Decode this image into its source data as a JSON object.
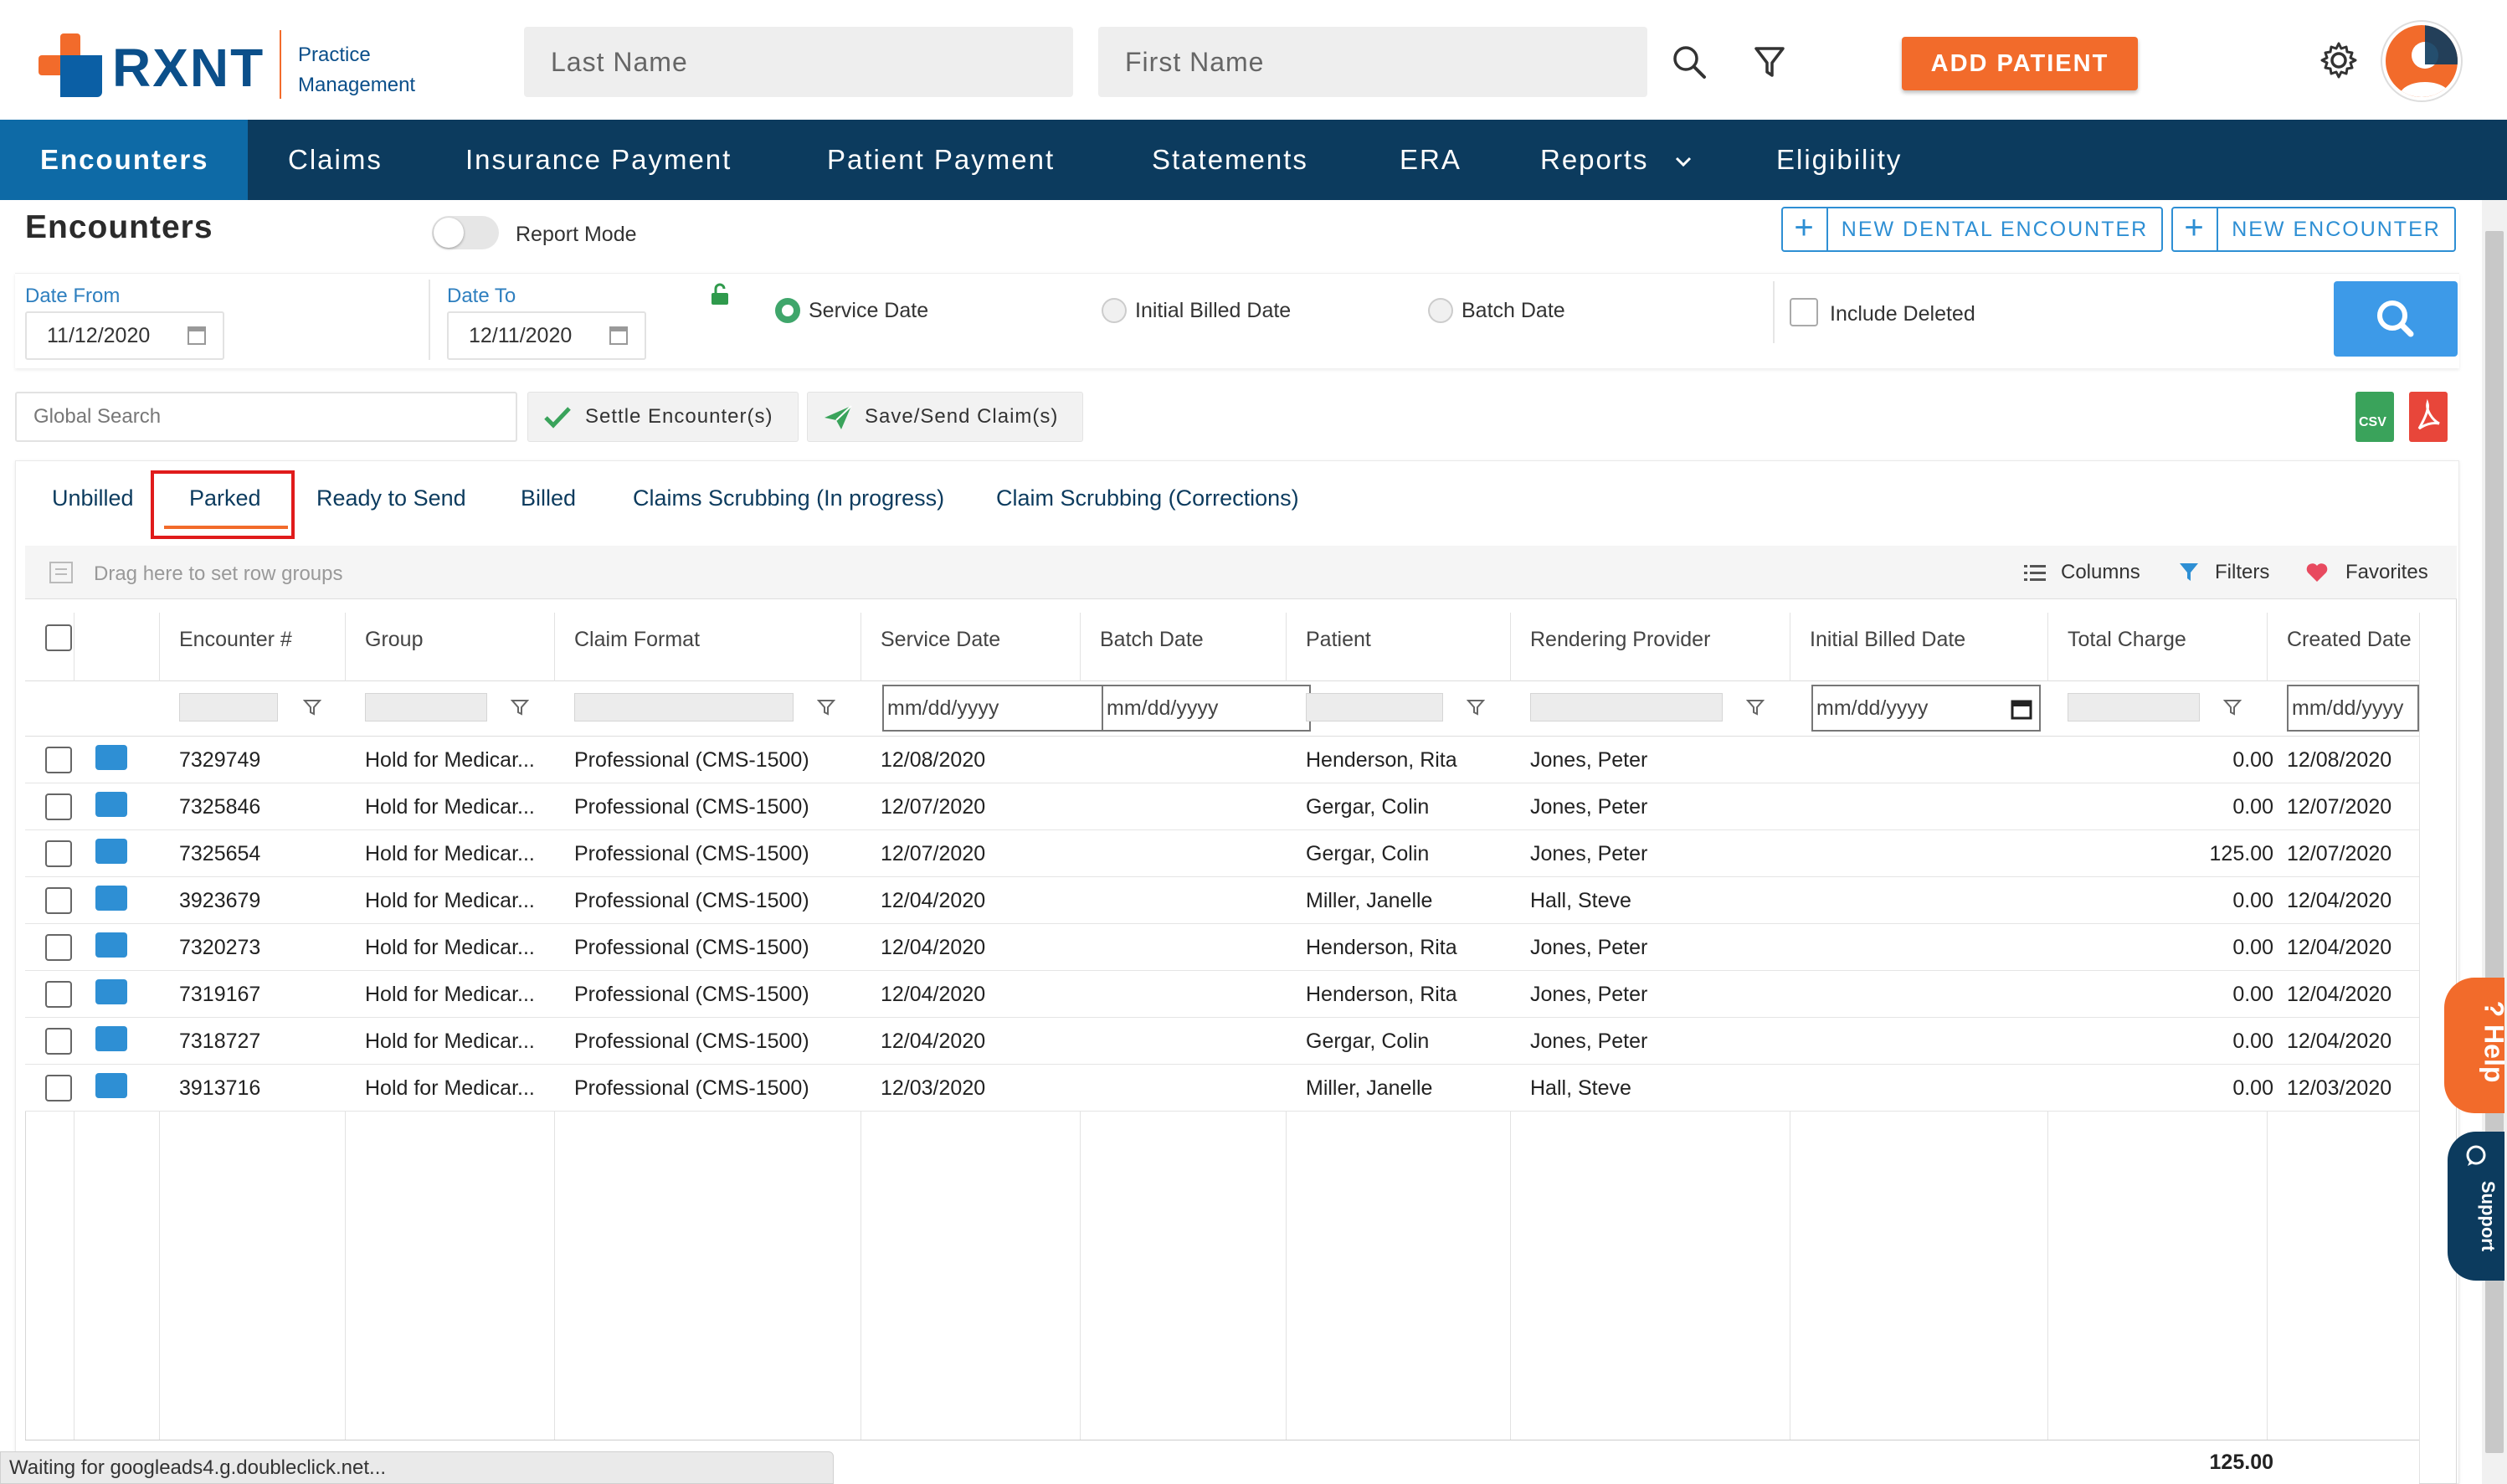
{
  "brand": {
    "name": "RXNT",
    "sub_line1": "Practice",
    "sub_line2": "Management"
  },
  "search": {
    "last_name_placeholder": "Last Name",
    "first_name_placeholder": "First Name"
  },
  "header": {
    "add_patient_label": "ADD PATIENT"
  },
  "nav": {
    "items": [
      "Encounters",
      "Claims",
      "Insurance Payment",
      "Patient Payment",
      "Statements",
      "ERA",
      "Reports",
      "Eligibility"
    ],
    "active": "Encounters"
  },
  "page": {
    "title": "Encounters",
    "report_mode_label": "Report Mode",
    "new_dental_label": "NEW DENTAL ENCOUNTER",
    "new_encounter_label": "NEW ENCOUNTER"
  },
  "filters": {
    "date_from_label": "Date From",
    "date_from_value": "11/12/2020",
    "date_to_label": "Date To",
    "date_to_value": "12/11/2020",
    "radio_service": "Service Date",
    "radio_initial": "Initial Billed Date",
    "radio_batch": "Batch Date",
    "include_deleted": "Include Deleted"
  },
  "actions": {
    "global_search_placeholder": "Global Search",
    "settle_label": "Settle Encounter(s)",
    "save_send_label": "Save/Send Claim(s)",
    "csv_label": "CSV"
  },
  "tabs": [
    "Unbilled",
    "Parked",
    "Ready to Send",
    "Billed",
    "Claims Scrubbing (In progress)",
    "Claim Scrubbing (Corrections)"
  ],
  "active_tab": "Parked",
  "grid": {
    "drag_hint": "Drag here to set row groups",
    "columns_label": "Columns",
    "filters_label": "Filters",
    "favorites_label": "Favorites",
    "date_placeholder": "mm/dd/yyyy",
    "headers": [
      "Encounter #",
      "Group",
      "Claim Format",
      "Service Date",
      "Batch Date",
      "Patient",
      "Rendering Provider",
      "Initial Billed Date",
      "Total Charge",
      "Created Date"
    ],
    "rows": [
      {
        "enc": "7329749",
        "group": "Hold for Medicar...",
        "format": "Professional (CMS-1500)",
        "service": "12/08/2020",
        "batch": "",
        "patient": "Henderson, Rita",
        "provider": "Jones, Peter",
        "initial": "",
        "charge": "0.00",
        "created": "12/08/2020"
      },
      {
        "enc": "7325846",
        "group": "Hold for Medicar...",
        "format": "Professional (CMS-1500)",
        "service": "12/07/2020",
        "batch": "",
        "patient": "Gergar, Colin",
        "provider": "Jones, Peter",
        "initial": "",
        "charge": "0.00",
        "created": "12/07/2020"
      },
      {
        "enc": "7325654",
        "group": "Hold for Medicar...",
        "format": "Professional (CMS-1500)",
        "service": "12/07/2020",
        "batch": "",
        "patient": "Gergar, Colin",
        "provider": "Jones, Peter",
        "initial": "",
        "charge": "125.00",
        "created": "12/07/2020"
      },
      {
        "enc": "3923679",
        "group": "Hold for Medicar...",
        "format": "Professional (CMS-1500)",
        "service": "12/04/2020",
        "batch": "",
        "patient": "Miller, Janelle",
        "provider": "Hall, Steve",
        "initial": "",
        "charge": "0.00",
        "created": "12/04/2020"
      },
      {
        "enc": "7320273",
        "group": "Hold for Medicar...",
        "format": "Professional (CMS-1500)",
        "service": "12/04/2020",
        "batch": "",
        "patient": "Henderson, Rita",
        "provider": "Jones, Peter",
        "initial": "",
        "charge": "0.00",
        "created": "12/04/2020"
      },
      {
        "enc": "7319167",
        "group": "Hold for Medicar...",
        "format": "Professional (CMS-1500)",
        "service": "12/04/2020",
        "batch": "",
        "patient": "Henderson, Rita",
        "provider": "Jones, Peter",
        "initial": "",
        "charge": "0.00",
        "created": "12/04/2020"
      },
      {
        "enc": "7318727",
        "group": "Hold for Medicar...",
        "format": "Professional (CMS-1500)",
        "service": "12/04/2020",
        "batch": "",
        "patient": "Gergar, Colin",
        "provider": "Jones, Peter",
        "initial": "",
        "charge": "0.00",
        "created": "12/04/2020"
      },
      {
        "enc": "3913716",
        "group": "Hold for Medicar...",
        "format": "Professional (CMS-1500)",
        "service": "12/03/2020",
        "batch": "",
        "patient": "Miller, Janelle",
        "provider": "Hall, Steve",
        "initial": "",
        "charge": "0.00",
        "created": "12/03/2020"
      }
    ],
    "total_charge": "125.00"
  },
  "status_text": "Waiting for googleads4.g.doubleclick.net...",
  "side": {
    "help_label": "? Help",
    "support_label": "Support"
  },
  "colors": {
    "accent": "#f26b2b",
    "nav_bg": "#0c3b5e",
    "nav_active": "#0e6aa6",
    "primary_blue": "#2e8fd4"
  }
}
